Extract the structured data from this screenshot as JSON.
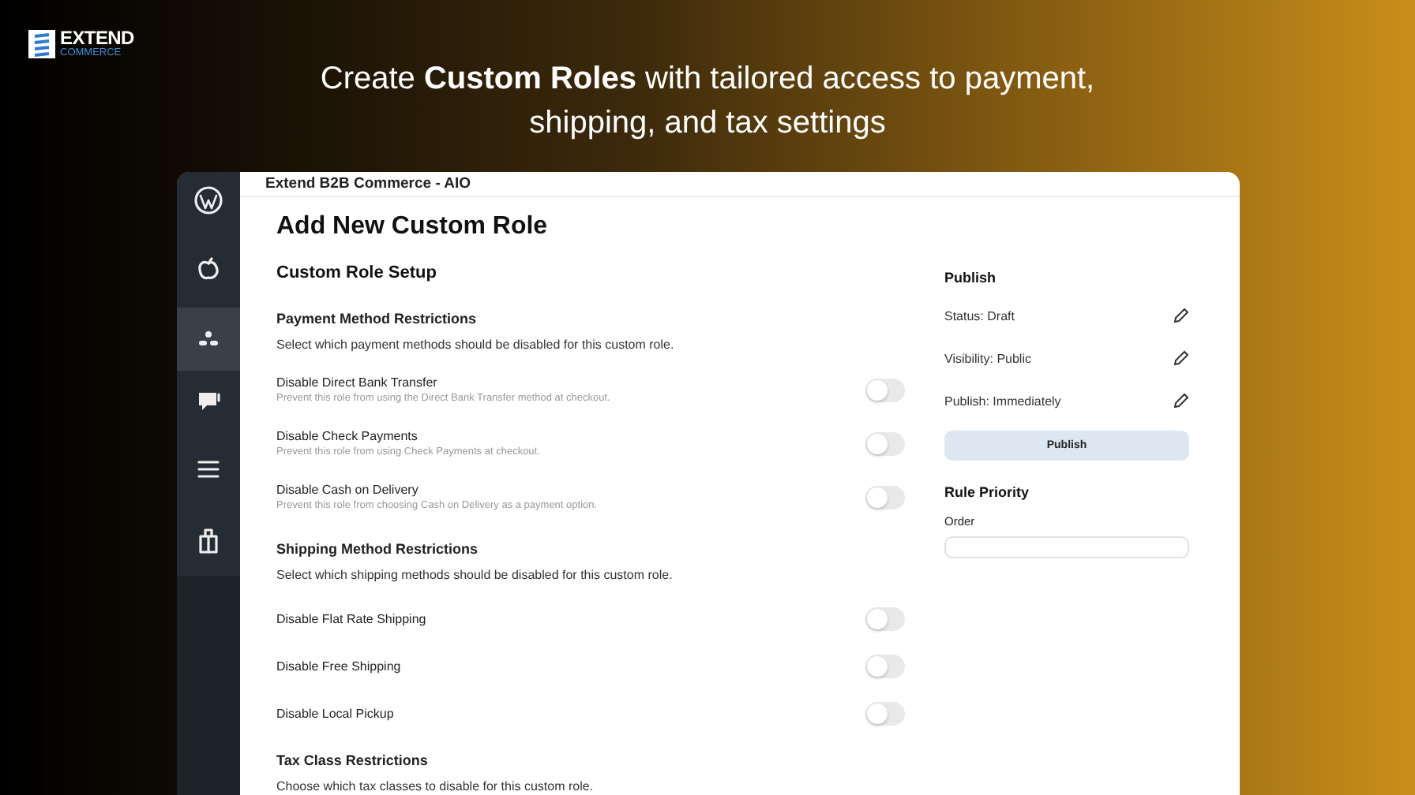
{
  "brand": {
    "name": "EXTEND",
    "subtitle": "COMMERCE"
  },
  "headline": "Create **Custom Roles** with tailored access to payment, shipping, and tax settings",
  "sidebar": {
    "items": [
      {
        "kind": "wordpress",
        "selected": false
      },
      {
        "kind": "apple",
        "selected": false
      },
      {
        "kind": "users",
        "selected": true
      },
      {
        "kind": "chat",
        "selected": false
      },
      {
        "kind": "menu",
        "selected": false
      },
      {
        "kind": "bag",
        "selected": false
      }
    ]
  },
  "window": {
    "title": "Extend B2B Commerce - AIO"
  },
  "page_title": "Add New Custom Role",
  "section_title": "Custom Role Setup",
  "groups": [
    {
      "title": "Payment Method Restrictions",
      "description": "Select which payment methods should be disabled for this custom role.",
      "options": [
        {
          "label": "Disable Direct Bank Transfer",
          "hint": "Prevent this role from using the Direct Bank Transfer method at checkout.",
          "on": false
        },
        {
          "label": "Disable Check Payments",
          "hint": "Prevent this role from using Check Payments at checkout.",
          "on": false
        },
        {
          "label": "Disable Cash on Delivery",
          "hint": "Prevent this role from choosing Cash on Delivery as a payment option.",
          "on": false
        }
      ]
    },
    {
      "title": "Shipping Method Restrictions",
      "description": "Select which shipping methods should be disabled for this custom role.",
      "options": [
        {
          "label": "Disable Flat Rate Shipping",
          "on": false
        },
        {
          "label": "Disable Free Shipping",
          "on": false
        },
        {
          "label": "Disable Local Pickup",
          "on": false
        }
      ]
    },
    {
      "title": "Tax Class Restrictions",
      "description": "Choose which tax classes to disable for this custom role."
    }
  ],
  "publish": {
    "title": "Publish",
    "fields": [
      "Status: Draft",
      "Visibility: Public",
      "Publish: Immediately"
    ],
    "button": "Publish"
  },
  "rule_priority": {
    "title": "Rule Priority",
    "field_label": "Order"
  }
}
